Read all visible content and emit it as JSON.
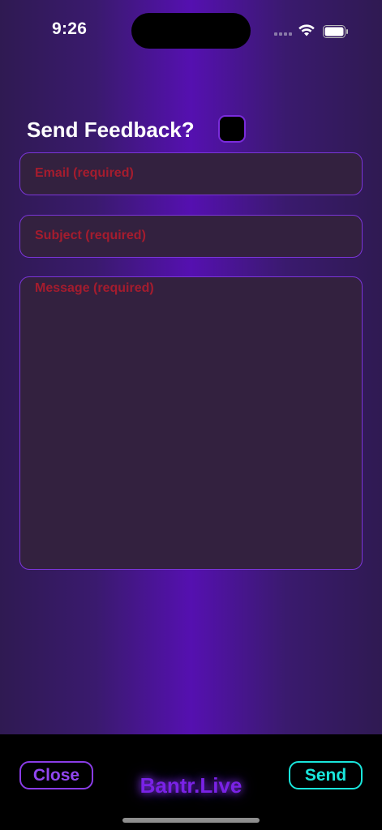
{
  "status_bar": {
    "time": "9:26"
  },
  "form": {
    "title": "Send Feedback?",
    "email_placeholder": "Email (required)",
    "subject_placeholder": "Subject (required)",
    "message_placeholder": "Message (required)"
  },
  "bottom_bar": {
    "close_label": "Close",
    "brand": "Bantr.Live",
    "send_label": "Send"
  },
  "colors": {
    "accent_purple": "#7b35d9",
    "send_cyan": "#19e6dc",
    "placeholder_red": "#a51c2e"
  }
}
